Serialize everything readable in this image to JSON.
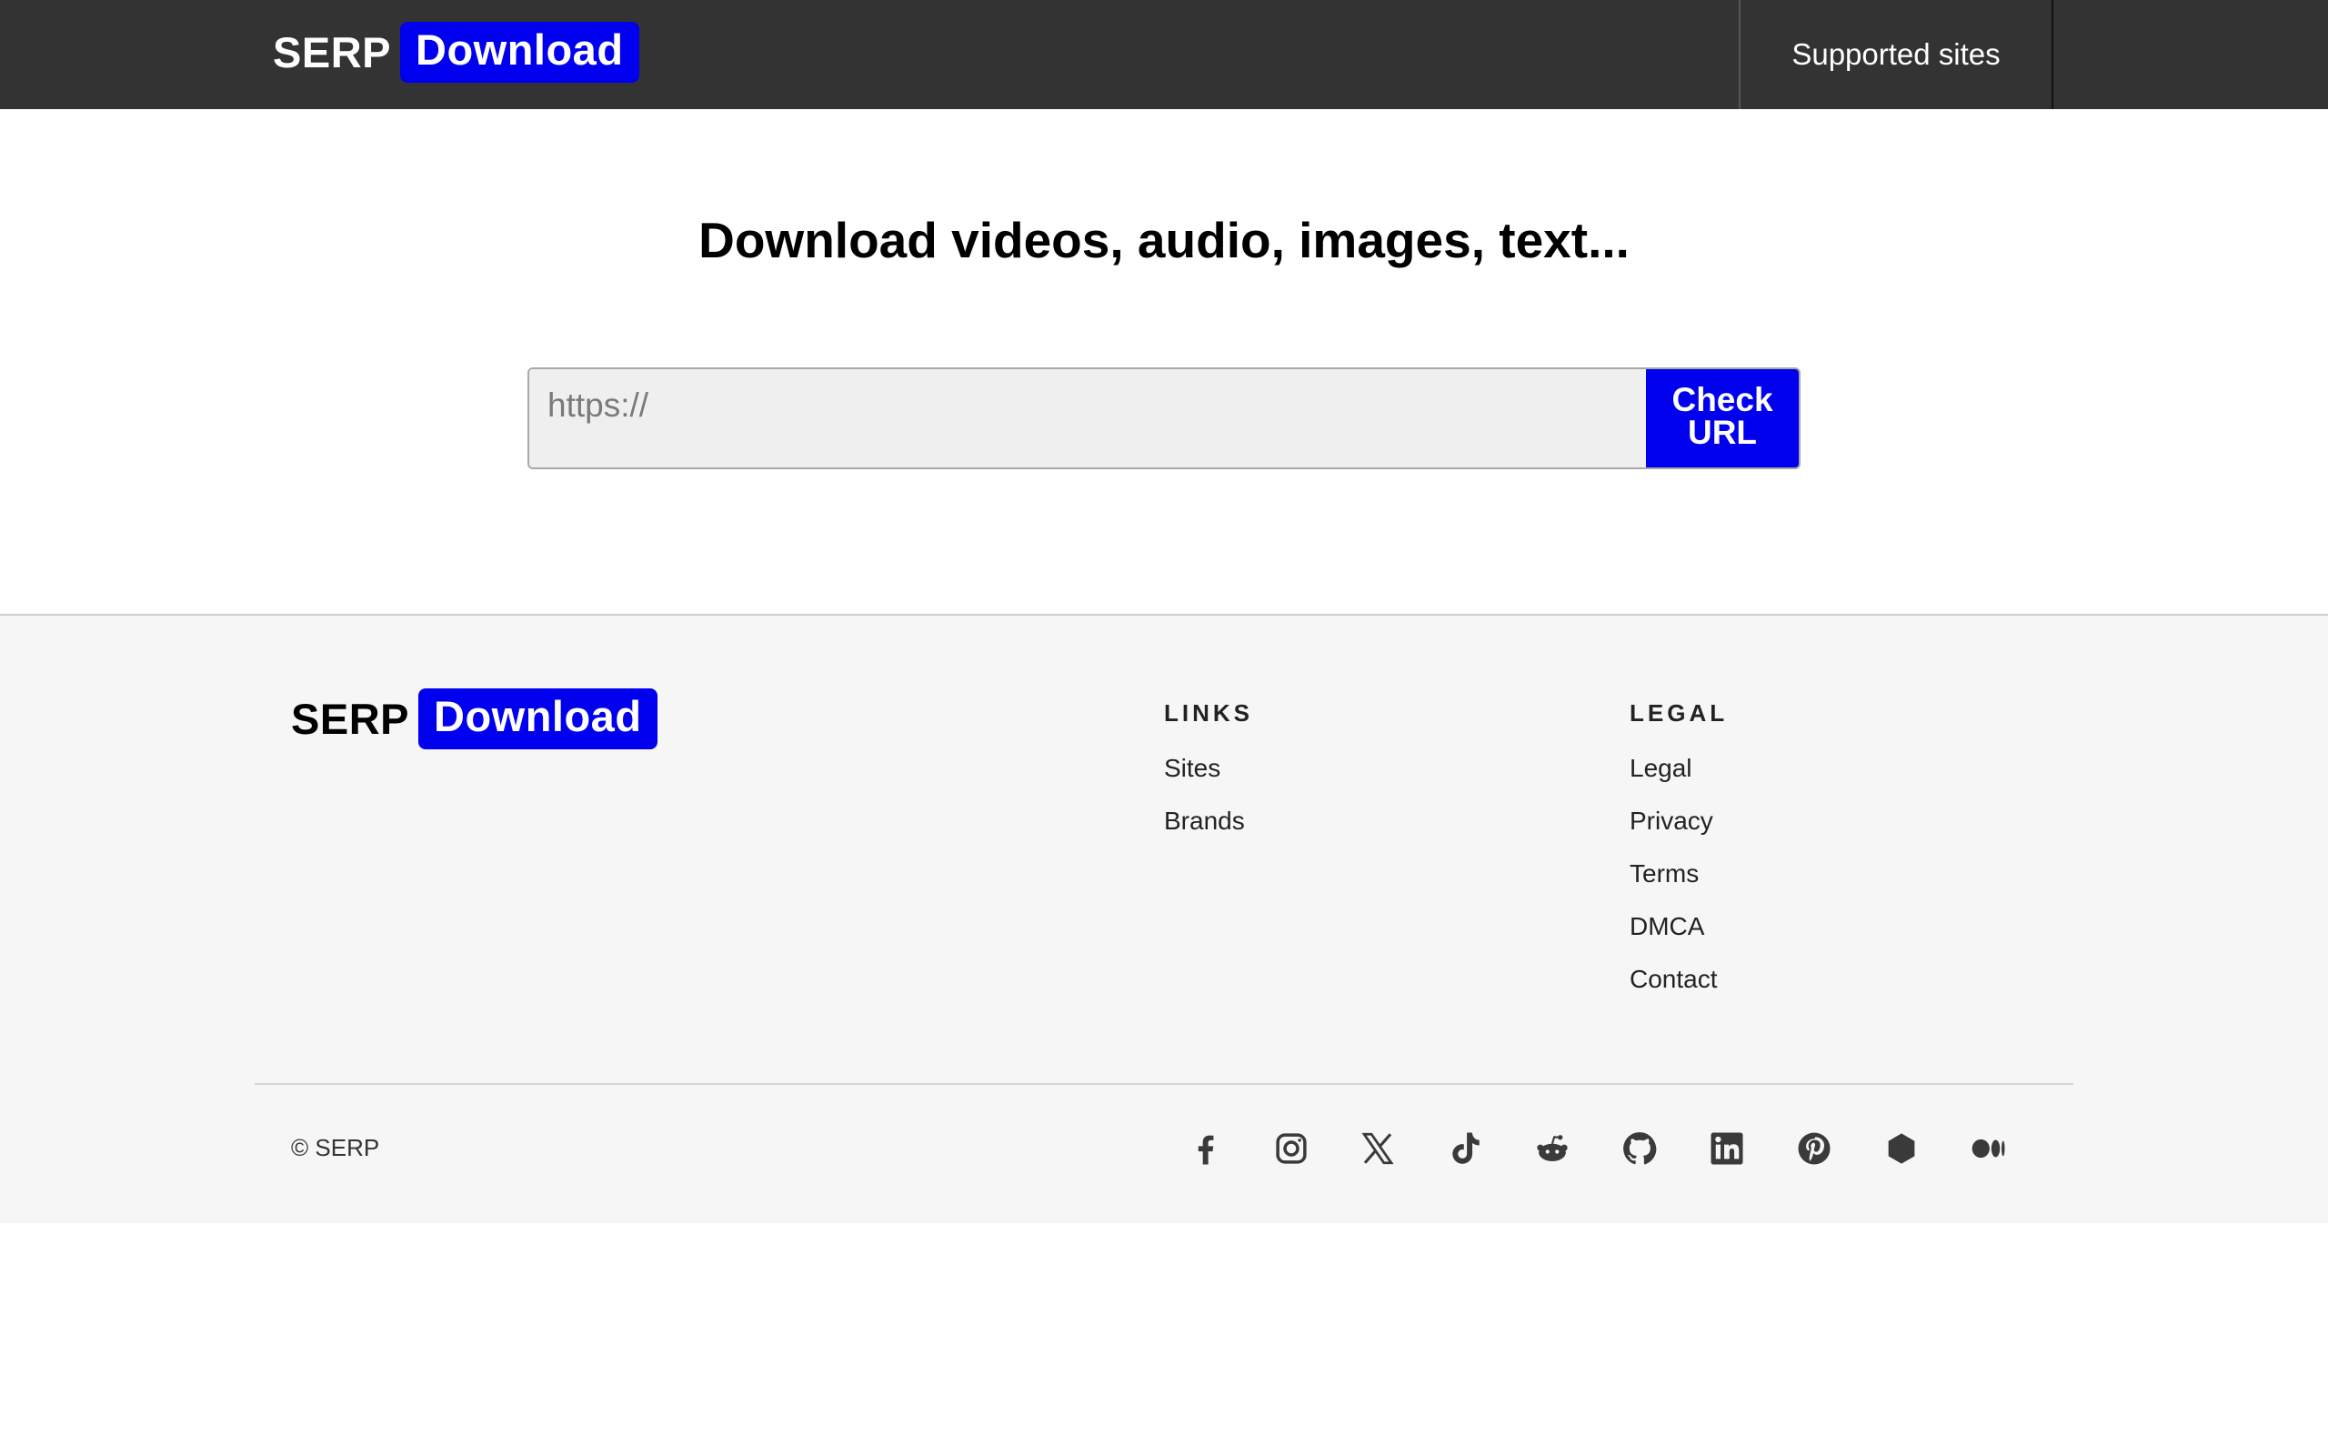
{
  "header": {
    "logo_left": "SERP",
    "logo_right": "Download",
    "nav_supported_sites": "Supported sites"
  },
  "hero": {
    "title": "Download videos, audio, images, text...",
    "input_placeholder": "https://",
    "check_line1": "Check",
    "check_line2": "URL"
  },
  "footer": {
    "logo_left": "SERP",
    "logo_right": "Download",
    "links_title": "LINKS",
    "links": [
      "Sites",
      "Brands"
    ],
    "legal_title": "LEGAL",
    "legal": [
      "Legal",
      "Privacy",
      "Terms",
      "DMCA",
      "Contact"
    ],
    "copyright": "© SERP",
    "social_icons": [
      "facebook-icon",
      "instagram-icon",
      "x-icon",
      "tiktok-icon",
      "reddit-icon",
      "github-icon",
      "linkedin-icon",
      "pinterest-icon",
      "hexagon-icon",
      "medium-icon"
    ]
  },
  "colors": {
    "header_bg": "#333333",
    "accent_blue": "#0000ee",
    "footer_bg": "#f6f6f6",
    "input_bg": "#efefef"
  }
}
